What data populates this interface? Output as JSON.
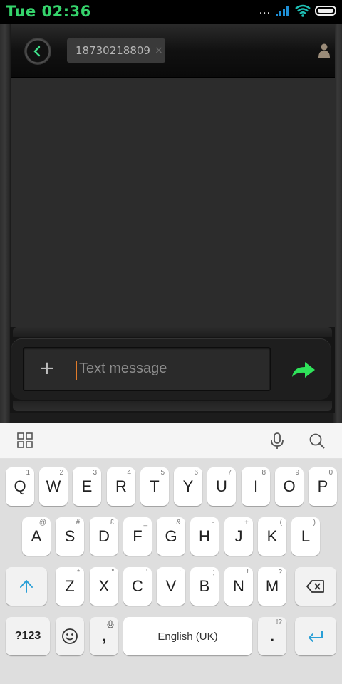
{
  "status_bar": {
    "time": "Tue 02:36",
    "dots": "...",
    "icons": [
      "signal-icon",
      "wifi-icon",
      "battery-icon"
    ]
  },
  "header": {
    "back_icon": "back-arrow-icon",
    "recipient": "18730218809",
    "chip_close": "×",
    "contact_icon": "contact-person-icon"
  },
  "composer": {
    "add_label": "+",
    "placeholder": "Text message",
    "send_icon": "send-arrow-icon"
  },
  "keyboard": {
    "toolbar": [
      "grid-menu-icon",
      "microphone-icon",
      "search-icon"
    ],
    "row1": [
      {
        "k": "Q",
        "h": "1"
      },
      {
        "k": "W",
        "h": "2"
      },
      {
        "k": "E",
        "h": "3"
      },
      {
        "k": "R",
        "h": "4"
      },
      {
        "k": "T",
        "h": "5"
      },
      {
        "k": "Y",
        "h": "6"
      },
      {
        "k": "U",
        "h": "7"
      },
      {
        "k": "I",
        "h": "8"
      },
      {
        "k": "O",
        "h": "9"
      },
      {
        "k": "P",
        "h": "0"
      }
    ],
    "row2": [
      {
        "k": "A",
        "h": "@"
      },
      {
        "k": "S",
        "h": "#"
      },
      {
        "k": "D",
        "h": "£"
      },
      {
        "k": "F",
        "h": "_"
      },
      {
        "k": "G",
        "h": "&"
      },
      {
        "k": "H",
        "h": "-"
      },
      {
        "k": "J",
        "h": "+"
      },
      {
        "k": "K",
        "h": "("
      },
      {
        "k": "L",
        "h": ")"
      }
    ],
    "row3": [
      {
        "k": "Z",
        "h": "*"
      },
      {
        "k": "X",
        "h": "\""
      },
      {
        "k": "C",
        "h": "'"
      },
      {
        "k": "V",
        "h": ":"
      },
      {
        "k": "B",
        "h": ";"
      },
      {
        "k": "N",
        "h": "!"
      },
      {
        "k": "M",
        "h": "?"
      }
    ],
    "symbols_label": "?123",
    "comma_label": ",",
    "space_label": "English (UK)",
    "period_label": ".",
    "period_hint": "!?",
    "shift_icon": "shift-arrow-icon",
    "backspace_icon": "backspace-icon",
    "emoji_icon": "emoji-icon",
    "enter_icon": "enter-icon",
    "accent_color": "#2a9fd6"
  }
}
